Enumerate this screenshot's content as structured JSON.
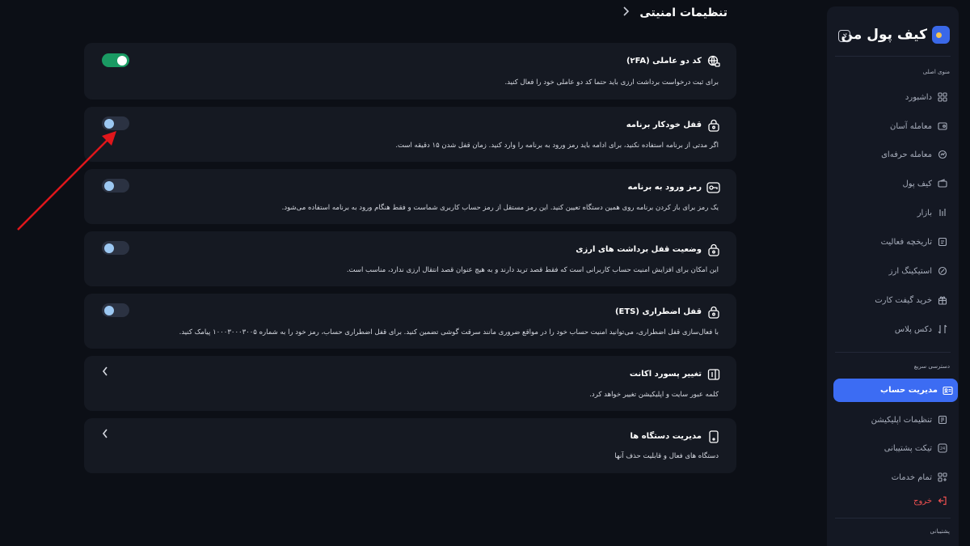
{
  "header": {
    "title": "تنظیمات امنیتی"
  },
  "brand": {
    "name": "کیف پول من"
  },
  "sidebar": {
    "main_title": "منوی اصلی",
    "items": [
      {
        "label": "داشبورد",
        "icon": "dashboard-icon"
      },
      {
        "label": "معامله آسان",
        "icon": "easy-trade-icon"
      },
      {
        "label": "معامله حرفه‌ای",
        "icon": "pro-trade-icon"
      },
      {
        "label": "کیف پول",
        "icon": "wallet-icon"
      },
      {
        "label": "بازار",
        "icon": "market-icon"
      },
      {
        "label": "تاریخچه فعالیت",
        "icon": "history-icon"
      },
      {
        "label": "استیکینگ ارز",
        "icon": "staking-icon"
      },
      {
        "label": "خرید گیفت کارت",
        "icon": "gift-icon"
      },
      {
        "label": "دکس پلاس",
        "icon": "dex-icon"
      }
    ],
    "quick_title": "دسترسی سریع",
    "quick_items": [
      {
        "label": "مدیریت حساب",
        "icon": "account-icon",
        "active": true
      },
      {
        "label": "تنظیمات اپلیکیشن",
        "icon": "app-settings-icon"
      },
      {
        "label": "تیکت پشتیبانی",
        "icon": "support-24-icon"
      },
      {
        "label": "تمام خدمات",
        "icon": "services-icon"
      },
      {
        "label": "خروج",
        "icon": "logout-icon"
      }
    ],
    "support_title": "پشتیبانی"
  },
  "cards": [
    {
      "title": "کد دو عاملی (۲FA)",
      "desc": "برای ثبت درخواست برداشت ارزی باید حتما کد دو عاملی خود را فعال کنید.",
      "icon": "globe-lock-icon",
      "control": "toggle",
      "on": true
    },
    {
      "title": "قفل خودکار برنامه",
      "desc": "اگر مدتی از برنامه استفاده نکنید، برای ادامه باید رمز ورود به برنامه را وارد کنید. زمان قفل شدن ۱۵ دقیقه است.",
      "icon": "lock-icon",
      "control": "toggle",
      "on": false
    },
    {
      "title": "رمز ورود به برنامه",
      "desc": "یک رمز برای باز کردن برنامه روی همین دستگاه تعیین کنید. این رمز مستقل از رمز حساب کاربری شماست و فقط هنگام ورود به برنامه استفاده می‌شود.",
      "icon": "key-icon",
      "control": "toggle",
      "on": false
    },
    {
      "title": "وضعیت قفل برداشت های ارزی",
      "desc": "این امکان برای افزایش امنیت حساب کاربرانی است که فقط قصد ترید دارند و به هیچ عنوان قصد انتقال ارزی ندارد، مناسب است.",
      "icon": "lock-icon",
      "control": "toggle",
      "on": false
    },
    {
      "title": "قفل اضطراری (ETS)",
      "desc": "با فعال‌سازی قفل اضطراری، می‌توانید امنیت حساب خود را در مواقع ضروری مانند سرقت گوشی تضمین کنید. برای قفل اضطراری حساب، رمز خود را به شماره ۱۰۰۰۳۰۰۰۳۰۰۵ پیامک کنید.",
      "icon": "lock-icon",
      "control": "toggle",
      "on": false
    },
    {
      "title": "تغییر پسورد اکانت",
      "desc": "کلمه عبور سایت و اپلیکیشن تغییر خواهد کرد.",
      "icon": "password-field-icon",
      "control": "chevron"
    },
    {
      "title": "مدیریت دستگاه ها",
      "desc": "دستگاه های فعال و قابلیت حذف آنها",
      "icon": "device-icon",
      "control": "chevron"
    }
  ],
  "annotation": {
    "color": "#e0161b"
  }
}
